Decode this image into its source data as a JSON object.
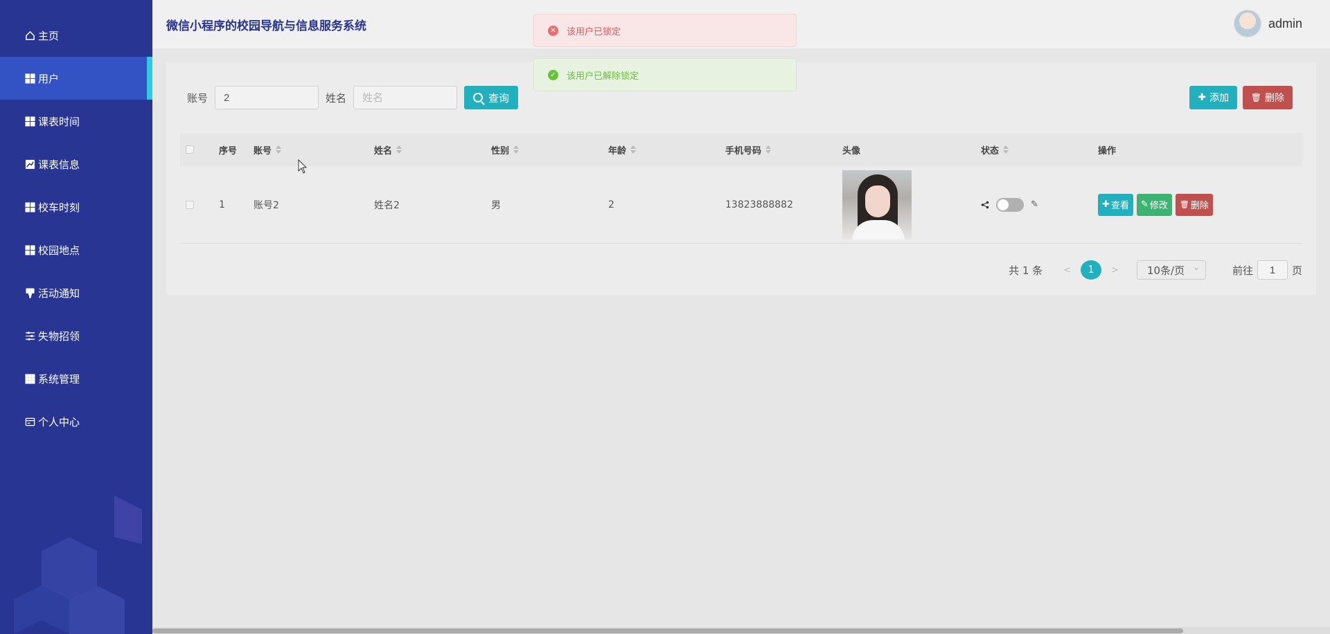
{
  "app": {
    "title": "微信小程序的校园导航与信息服务系统",
    "username": "admin"
  },
  "sidebar": {
    "items": [
      {
        "label": "主页",
        "icon": "home-icon"
      },
      {
        "label": "用户",
        "icon": "grid-icon",
        "active": true
      },
      {
        "label": "课表时间",
        "icon": "grid-icon"
      },
      {
        "label": "课表信息",
        "icon": "line-chart-icon"
      },
      {
        "label": "校车时刻",
        "icon": "grid-icon"
      },
      {
        "label": "校园地点",
        "icon": "grid-icon"
      },
      {
        "label": "活动通知",
        "icon": "pin-icon"
      },
      {
        "label": "失物招领",
        "icon": "sliders-icon"
      },
      {
        "label": "系统管理",
        "icon": "apps-icon"
      },
      {
        "label": "个人中心",
        "icon": "card-icon"
      }
    ]
  },
  "toasts": {
    "error": "该用户已锁定",
    "success": "该用户已解除锁定"
  },
  "search": {
    "account_label": "账号",
    "account_value": "2",
    "name_label": "姓名",
    "name_placeholder": "姓名",
    "query_label": "查询"
  },
  "toolbar": {
    "add_label": "添加",
    "delete_label": "删除"
  },
  "table": {
    "headers": {
      "index": "序号",
      "account": "账号",
      "name": "姓名",
      "gender": "性别",
      "age": "年龄",
      "phone": "手机号码",
      "avatar": "头像",
      "status": "状态",
      "ops": "操作"
    },
    "rows": [
      {
        "index": "1",
        "account": "账号2",
        "name": "姓名2",
        "gender": "男",
        "age": "2",
        "phone": "13823888882",
        "locked": false
      }
    ],
    "ops": {
      "view": "查看",
      "edit": "修改",
      "delete": "删除"
    }
  },
  "pagination": {
    "total": "共 1 条",
    "current": "1",
    "page_size": "10条/页",
    "goto_label": "前往",
    "goto_value": "1",
    "page_unit": "页",
    "prev": "<",
    "next": ">"
  },
  "colors": {
    "sidebar": "#283593",
    "accent": "#22b0bf",
    "danger": "#c0504d",
    "success": "#3cb371"
  }
}
